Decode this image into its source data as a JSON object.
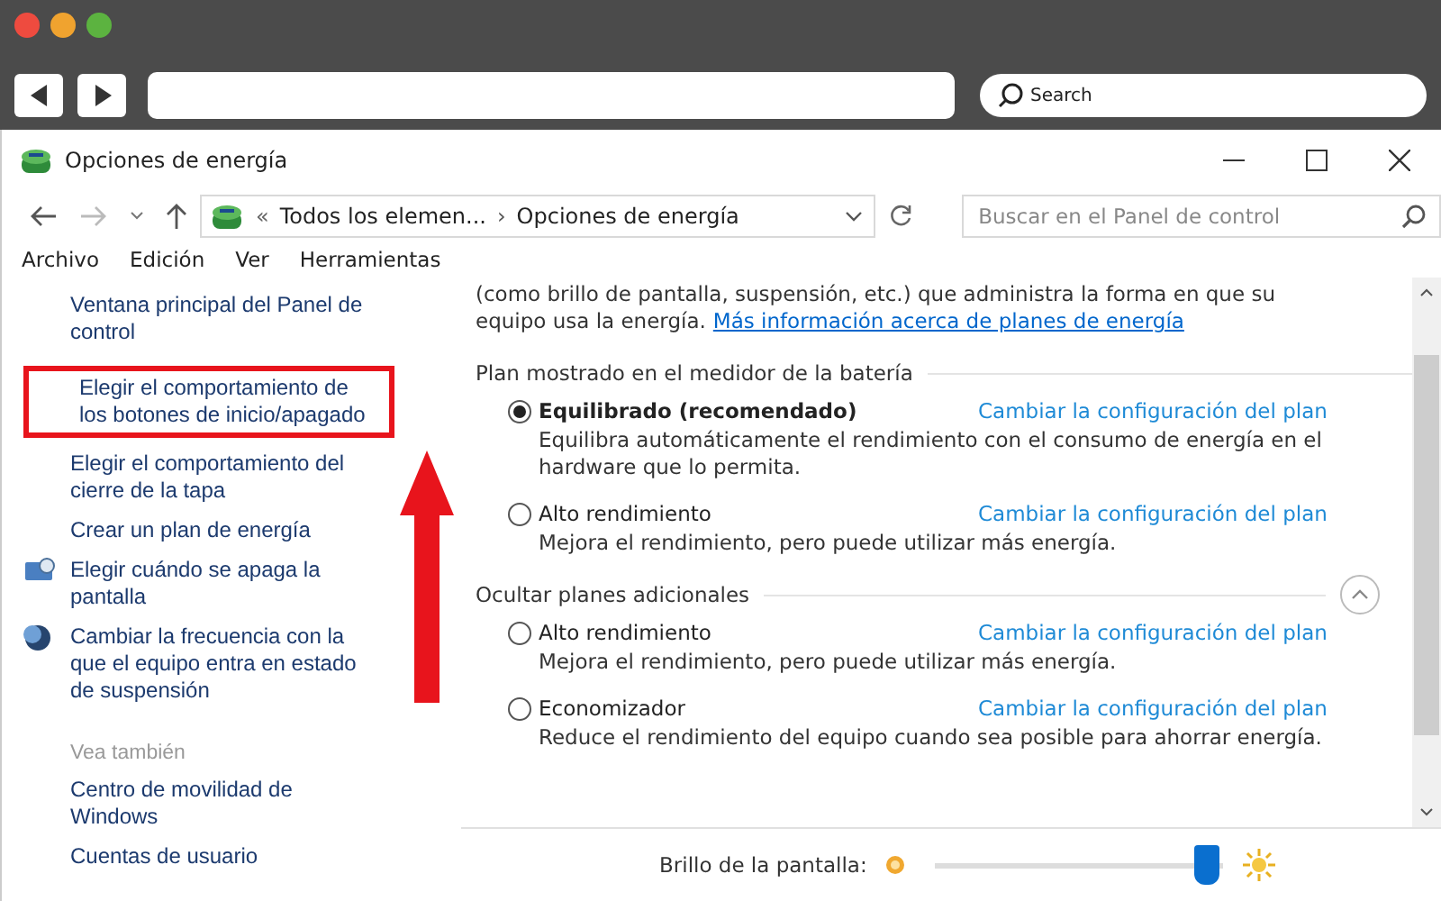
{
  "browser": {
    "search_placeholder": "Search"
  },
  "window": {
    "title": "Opciones de energía"
  },
  "address_bar": {
    "prefix": "«",
    "crumbs": [
      "Todos los elemen...",
      "Opciones de energía"
    ],
    "separator": "›",
    "search_placeholder": "Buscar en el Panel de control"
  },
  "menu": [
    "Archivo",
    "Edición",
    "Ver",
    "Herramientas"
  ],
  "sidebar": {
    "items": [
      {
        "label": "Ventana principal del Panel de control",
        "highlighted": false
      },
      {
        "label": "Elegir el comportamiento de los botones de inicio/apagado",
        "highlighted": true
      },
      {
        "label": "Elegir el comportamiento del cierre de la tapa",
        "highlighted": false
      },
      {
        "label": "Crear un plan de energía",
        "highlighted": false
      },
      {
        "label": "Elegir cuándo se apaga la pantalla",
        "highlighted": false
      },
      {
        "label": "Cambiar la frecuencia con la que el equipo entra en estado de suspensión",
        "highlighted": false
      }
    ],
    "see_also_title": "Vea también",
    "see_also": [
      "Centro de movilidad de Windows",
      "Cuentas de usuario"
    ]
  },
  "intro": {
    "lines": [
      "(como brillo de pantalla, suspensión, etc.) que administra la forma en que su",
      "equipo usa la energía."
    ],
    "link": "Más información acerca de planes de energía"
  },
  "sections": [
    {
      "title": "Plan mostrado en el medidor de la batería",
      "collapse": false,
      "plans": [
        {
          "name": "Equilibrado (recomendado)",
          "selected": true,
          "link": "Cambiar la configuración del plan",
          "description": "Equilibra automáticamente el rendimiento con el consumo de energía en el hardware que lo permita."
        },
        {
          "name": "Alto rendimiento",
          "selected": false,
          "link": "Cambiar la configuración del plan",
          "description": "Mejora el rendimiento, pero puede utilizar más energía."
        }
      ]
    },
    {
      "title": "Ocultar planes adicionales",
      "collapse": true,
      "plans": [
        {
          "name": "Alto rendimiento",
          "selected": false,
          "link": "Cambiar la configuración del plan",
          "description": "Mejora el rendimiento, pero puede utilizar más energía."
        },
        {
          "name": "Economizador",
          "selected": false,
          "link": "Cambiar la configuración del plan",
          "description": "Reduce el rendimiento del equipo cuando sea posible para ahorrar energía."
        }
      ]
    }
  ],
  "brightness": {
    "label": "Brillo de la pantalla:",
    "level": 0.95
  }
}
